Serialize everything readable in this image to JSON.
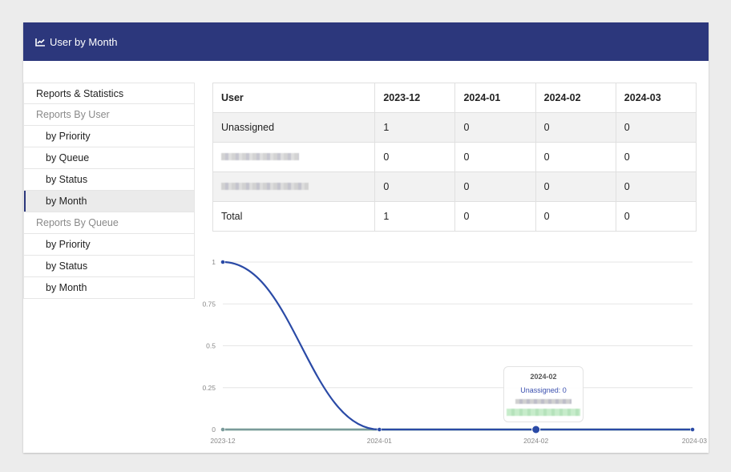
{
  "header": {
    "title": "User by Month",
    "icon": "chart-line-icon",
    "color": "#2c377c"
  },
  "sidebar": {
    "items": [
      {
        "label": "Reports & Statistics",
        "type": "top"
      },
      {
        "label": "Reports By User",
        "type": "group"
      },
      {
        "label": "by Priority",
        "type": "sub"
      },
      {
        "label": "by Queue",
        "type": "sub"
      },
      {
        "label": "by Status",
        "type": "sub"
      },
      {
        "label": "by Month",
        "type": "sub",
        "active": true
      },
      {
        "label": "Reports By Queue",
        "type": "group"
      },
      {
        "label": "by Priority",
        "type": "sub"
      },
      {
        "label": "by Status",
        "type": "sub"
      },
      {
        "label": "by Month",
        "type": "sub"
      }
    ]
  },
  "table": {
    "headers": [
      "User",
      "2023-12",
      "2024-01",
      "2024-02",
      "2024-03"
    ],
    "rows": [
      {
        "user": "Unassigned",
        "values": [
          "1",
          "0",
          "0",
          "0"
        ]
      },
      {
        "user": "[redacted]",
        "values": [
          "0",
          "0",
          "0",
          "0"
        ]
      },
      {
        "user": "[redacted]",
        "values": [
          "0",
          "0",
          "0",
          "0"
        ]
      },
      {
        "user": "Total",
        "values": [
          "1",
          "0",
          "0",
          "0"
        ]
      }
    ]
  },
  "tooltip": {
    "title": "2024-02",
    "line": "Unassigned: 0"
  },
  "chart_data": {
    "type": "line",
    "x": [
      "2023-12",
      "2024-01",
      "2024-02",
      "2024-03"
    ],
    "series": [
      {
        "name": "Unassigned",
        "values": [
          1,
          0,
          0,
          0
        ],
        "color": "#2a4aa6"
      },
      {
        "name": "[redacted user 1]",
        "values": [
          0,
          0,
          0,
          0
        ],
        "color": "#7a9a9a"
      },
      {
        "name": "[redacted user 2]",
        "values": [
          0,
          0,
          0,
          0
        ],
        "color": "#8fd49a"
      }
    ],
    "yticks": [
      "0",
      "0.25",
      "0.5",
      "0.75",
      "1"
    ],
    "ylim": [
      0,
      1
    ],
    "grid": true,
    "highlighted_point": "2024-02"
  }
}
